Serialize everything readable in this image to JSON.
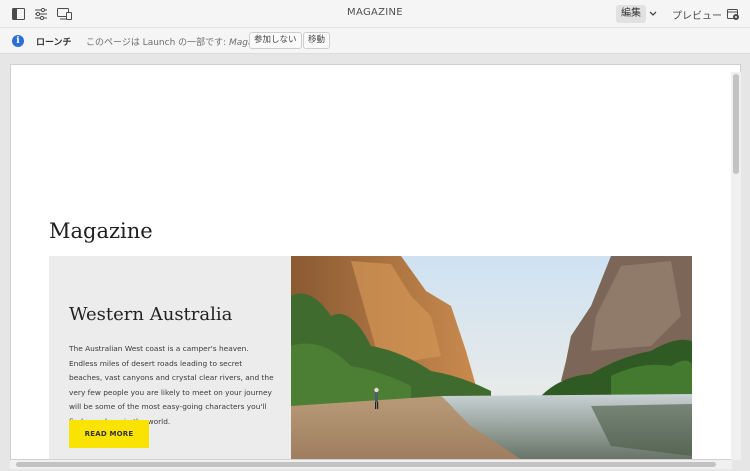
{
  "toolbar": {
    "title": "MAGAZINE",
    "edit_label": "編集",
    "preview_label": "プレビュー",
    "icons": [
      "side-panel-icon",
      "page-properties-icon",
      "emulator-icon",
      "chevron-down-icon",
      "page-info-icon"
    ]
  },
  "launch_bar": {
    "label": "ローンチ",
    "message_prefix": "このページは Launch の一部です: ",
    "launch_name": "Magazine",
    "buttons": [
      "参加しない",
      "移動"
    ]
  },
  "page": {
    "heading": "Magazine",
    "teaser": {
      "title": "Western Australia",
      "description": "The Australian West coast is a camper's heaven. Endless miles of desert roads leading to secret beaches, vast canyons and crystal clear rivers, and the very few people you are likely to meet on your journey will be some of the most easy-going characters you'll find anywhere in the world.",
      "button_label": "READ MORE"
    }
  },
  "colors": {
    "accent_button": "#fbe300",
    "info_icon": "#2b6fd6",
    "teaser_background": "#ececec"
  }
}
